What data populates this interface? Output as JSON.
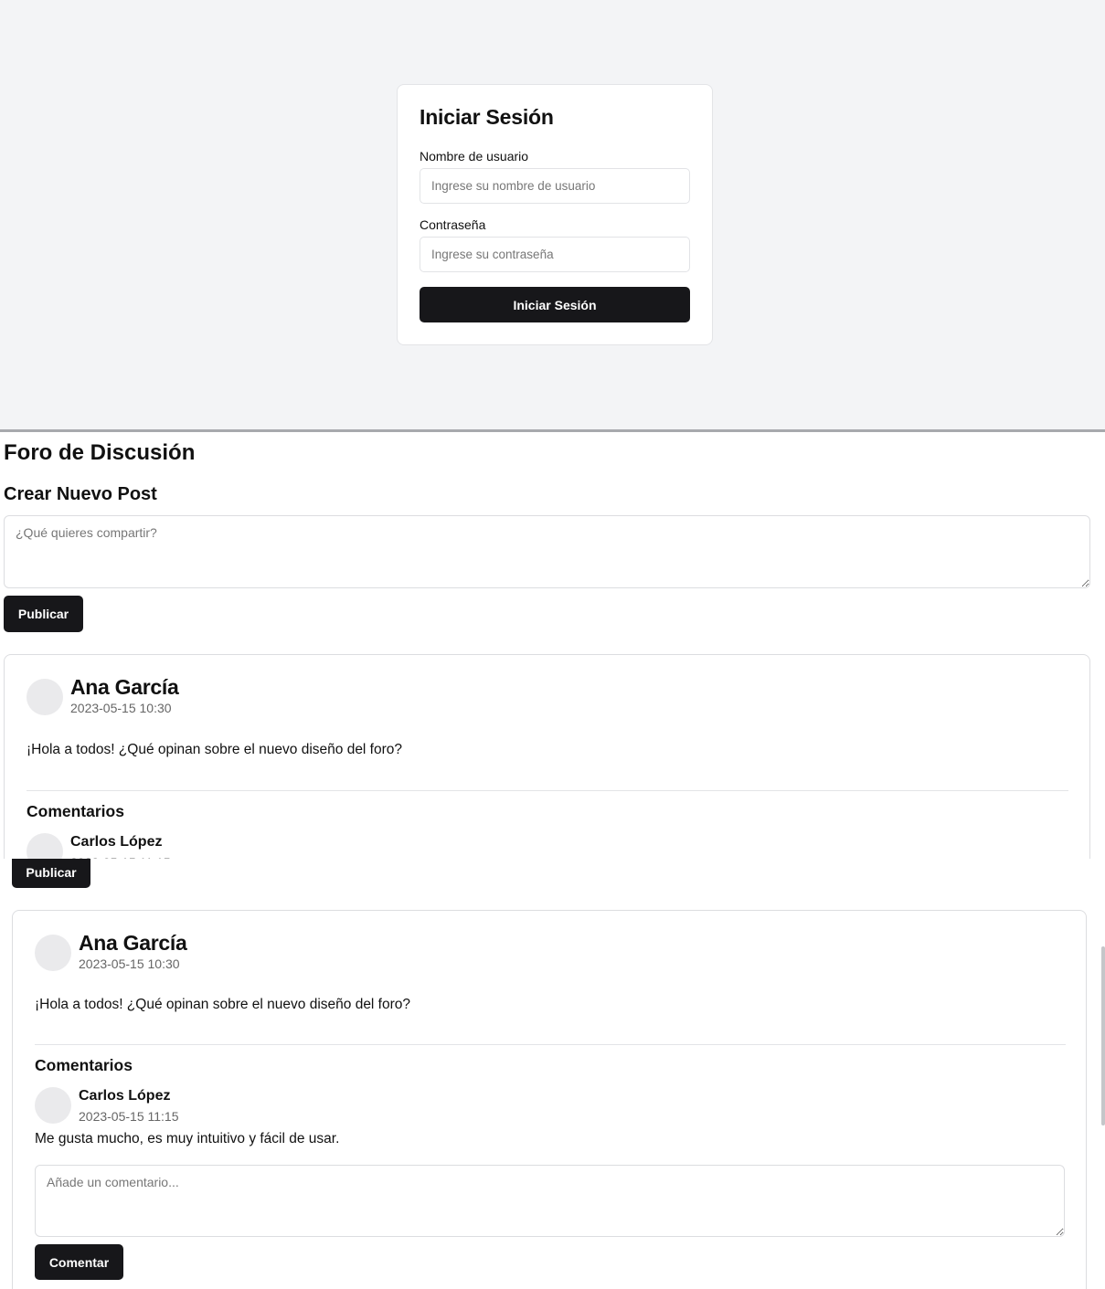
{
  "login": {
    "title": "Iniciar Sesión",
    "username_label": "Nombre de usuario",
    "username_placeholder": "Ingrese su nombre de usuario",
    "password_label": "Contraseña",
    "password_placeholder": "Ingrese su contraseña",
    "submit_label": "Iniciar Sesión"
  },
  "forum": {
    "title": "Foro de Discusión",
    "new_post_title": "Crear Nuevo Post",
    "new_post_placeholder": "¿Qué quieres compartir?",
    "publish_label": "Publicar",
    "post": {
      "author": "Ana García",
      "time": "2023-05-15 10:30",
      "body": "¡Hola a todos! ¿Qué opinan sobre el nuevo diseño del foro?",
      "comments_title": "Comentarios",
      "comment": {
        "author": "Carlos López",
        "time": "2023-05-15 11:15",
        "body": "Me gusta mucho, es muy intuitivo y fácil de usar."
      },
      "comment_placeholder": "Añade un comentario...",
      "comment_button_label": "Comentar"
    }
  },
  "colors": {
    "page_bg": "#f3f4f6",
    "primary_button": "#17171a",
    "muted_text": "#666666"
  }
}
